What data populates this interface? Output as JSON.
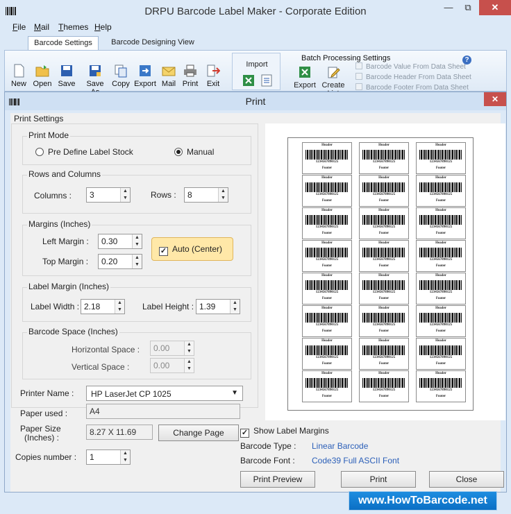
{
  "window": {
    "title": "DRPU Barcode Label Maker - Corporate Edition",
    "controls": {
      "minimize": "—",
      "maximize": "⧉",
      "close": "✕"
    }
  },
  "menu": [
    {
      "first": "F",
      "rest": "ile"
    },
    {
      "first": "M",
      "rest": "ail"
    },
    {
      "first": "T",
      "rest": "hemes"
    },
    {
      "first": "H",
      "rest": "elp"
    }
  ],
  "tabs": {
    "active": "Barcode Settings",
    "inactive": "Barcode Designing View"
  },
  "toolbar": {
    "new": "New",
    "open": "Open",
    "save": "Save",
    "save_as": "Save As",
    "copy": "Copy",
    "export": "Export",
    "mail": "Mail",
    "print": "Print",
    "exit": "Exit"
  },
  "import_group": {
    "label": "Import"
  },
  "batch": {
    "title": "Batch Processing Settings",
    "export": "Export",
    "create_list": "Create List",
    "options": [
      "Barcode Value From Data Sheet",
      "Barcode Header From Data Sheet",
      "Barcode Footer From Data Sheet"
    ],
    "help": "?"
  },
  "dialog": {
    "title": "Print",
    "close": "✕",
    "print_settings": "Print Settings",
    "print_mode": {
      "title": "Print Mode",
      "option1": "Pre Define Label Stock",
      "option2": "Manual",
      "selected": "Manual"
    },
    "rows_columns": {
      "title": "Rows and Columns",
      "columns_label": "Columns :",
      "columns_value": "3",
      "rows_label": "Rows :",
      "rows_value": "8"
    },
    "margins": {
      "title": "Margins (Inches)",
      "left_label": "Left Margin :",
      "left_value": "0.30",
      "top_label": "Top Margin :",
      "top_value": "0.20",
      "auto_label": "Auto (Center)",
      "auto_checked": true
    },
    "label_margin": {
      "title": "Label Margin (Inches)",
      "width_label": "Label Width :",
      "width_value": "2.18",
      "height_label": "Label Height :",
      "height_value": "1.39"
    },
    "barcode_space": {
      "title": "Barcode Space (Inches)",
      "horizontal_label": "Horizontal Space :",
      "horizontal_value": "0.00",
      "vertical_label": "Vertical Space :",
      "vertical_value": "0.00"
    },
    "printer": {
      "name_label": "Printer Name :",
      "name_value": "HP LaserJet CP 1025",
      "paper_label": "Paper used :",
      "paper_value": "A4",
      "size_label_1": "Paper Size",
      "size_label_2": "(Inches) :",
      "size_value": "8.27 X 11.69",
      "change_page": "Change Page",
      "copies_label": "Copies number :",
      "copies_value": "1"
    },
    "show_margins": {
      "label": "Show Label Margins",
      "checked": true
    },
    "barcode_type_label": "Barcode Type :",
    "barcode_type_value": "Linear Barcode",
    "barcode_font_label": "Barcode Font :",
    "barcode_font_value": "Code39 Full ASCII Font",
    "buttons": {
      "preview": "Print Preview",
      "print": "Print",
      "close": "Close"
    }
  },
  "label_sample": {
    "header": "Header",
    "value": "1234567890125",
    "footer": "Footer"
  },
  "watermark": "www.HowToBarcode.net"
}
